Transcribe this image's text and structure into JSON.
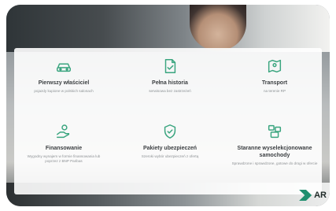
{
  "features": [
    {
      "icon": "car-icon",
      "title": "Pierwszy właściciel",
      "description": "pojazdy kupione w polskich salonach"
    },
    {
      "icon": "document-check-icon",
      "title": "Pełna historia",
      "description": "serwisowa bez zastrzeżeń"
    },
    {
      "icon": "map-pin-icon",
      "title": "Transport",
      "description": "na terenie RP"
    },
    {
      "icon": "money-hand-icon",
      "title": "Finansowanie",
      "description": "Wygodny wynajem w formie finansowania lub poprzez z BNP Paribas"
    },
    {
      "icon": "shield-icon",
      "title": "Pakiety ubezpieczeń",
      "description": "Szeroki wybór ubezpieczeń z ofertą"
    },
    {
      "icon": "stack-icon",
      "title": "Staranne wyselekcjonowane samochody",
      "description": "Sprawdzone i sprawdzone, gotowe do drogi w ofercie"
    }
  ],
  "brand": {
    "name": "AR",
    "accent": "#1f8f6f",
    "icon": "logo-mark"
  }
}
